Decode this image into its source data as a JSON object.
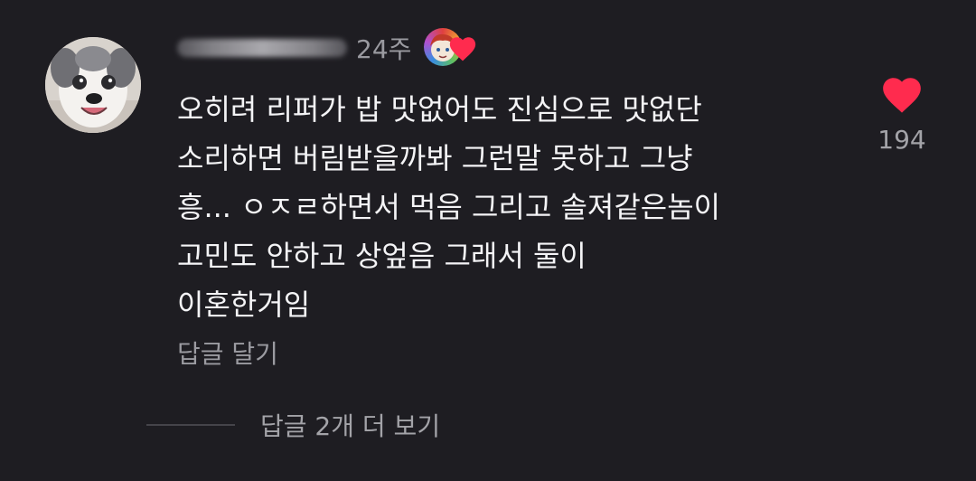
{
  "comment": {
    "time": "24주",
    "text": "오히려 리퍼가 밥 맛없어도 진심으로 맛없단\n소리하면 버림받을까봐 그런말 못하고 그냥\n흥... ㅇㅈㄹ하면서 먹음 그리고 솔져같은놈이\n고민도 안하고 상엎음 그래서 둘이\n이혼한거임",
    "reply_label": "답글 달기",
    "like_count": "194"
  },
  "replies": {
    "more_label": "답글 2개 더 보기"
  },
  "colors": {
    "background": "#1e1d22",
    "like": "#ff2b4e",
    "muted": "#9b9ba1"
  },
  "icons": {
    "like": "heart-icon",
    "creator_like": "heart-icon"
  }
}
